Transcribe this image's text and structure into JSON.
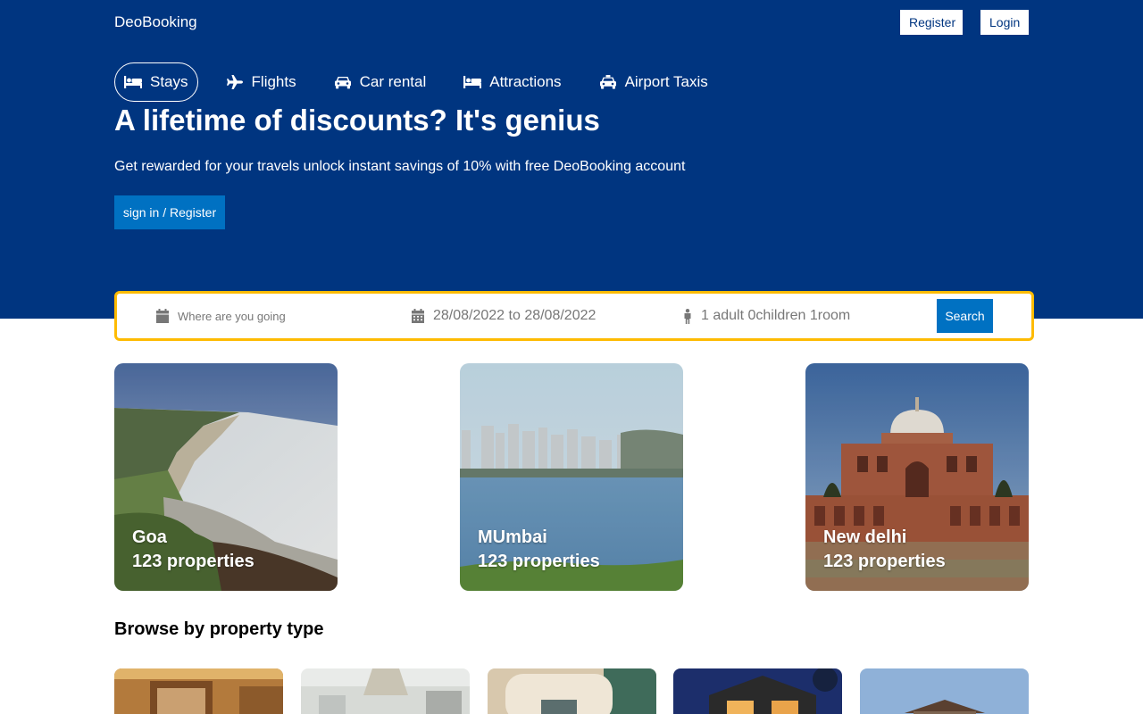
{
  "header": {
    "brand": "DeoBooking",
    "register_label": "Register",
    "login_label": "Login"
  },
  "nav": [
    {
      "label": "Stays",
      "icon": "bed-icon",
      "active": true
    },
    {
      "label": "Flights",
      "icon": "plane-icon",
      "active": false
    },
    {
      "label": "Car rental",
      "icon": "car-icon",
      "active": false
    },
    {
      "label": "Attractions",
      "icon": "bed-icon",
      "active": false
    },
    {
      "label": "Airport Taxis",
      "icon": "taxi-icon",
      "active": false
    }
  ],
  "hero": {
    "title": "A lifetime of discounts? It's genius",
    "subtitle": "Get rewarded for your travels unlock instant savings of 10% with free DeoBooking account",
    "cta_label": "sign in / Register"
  },
  "search": {
    "destination_placeholder": "Where are you going",
    "dates": "28/08/2022 to 28/08/2022",
    "people": "1 adult 0children 1room",
    "button_label": "Search"
  },
  "featured": [
    {
      "city": "Goa",
      "properties": "123 properties"
    },
    {
      "city": "MUmbai",
      "properties": "123 properties"
    },
    {
      "city": "New delhi",
      "properties": "123 properties"
    }
  ],
  "browse": {
    "title": "Browse by property type"
  },
  "colors": {
    "header_bg": "#003580",
    "accent": "#0071c2",
    "search_border": "#febb02"
  }
}
